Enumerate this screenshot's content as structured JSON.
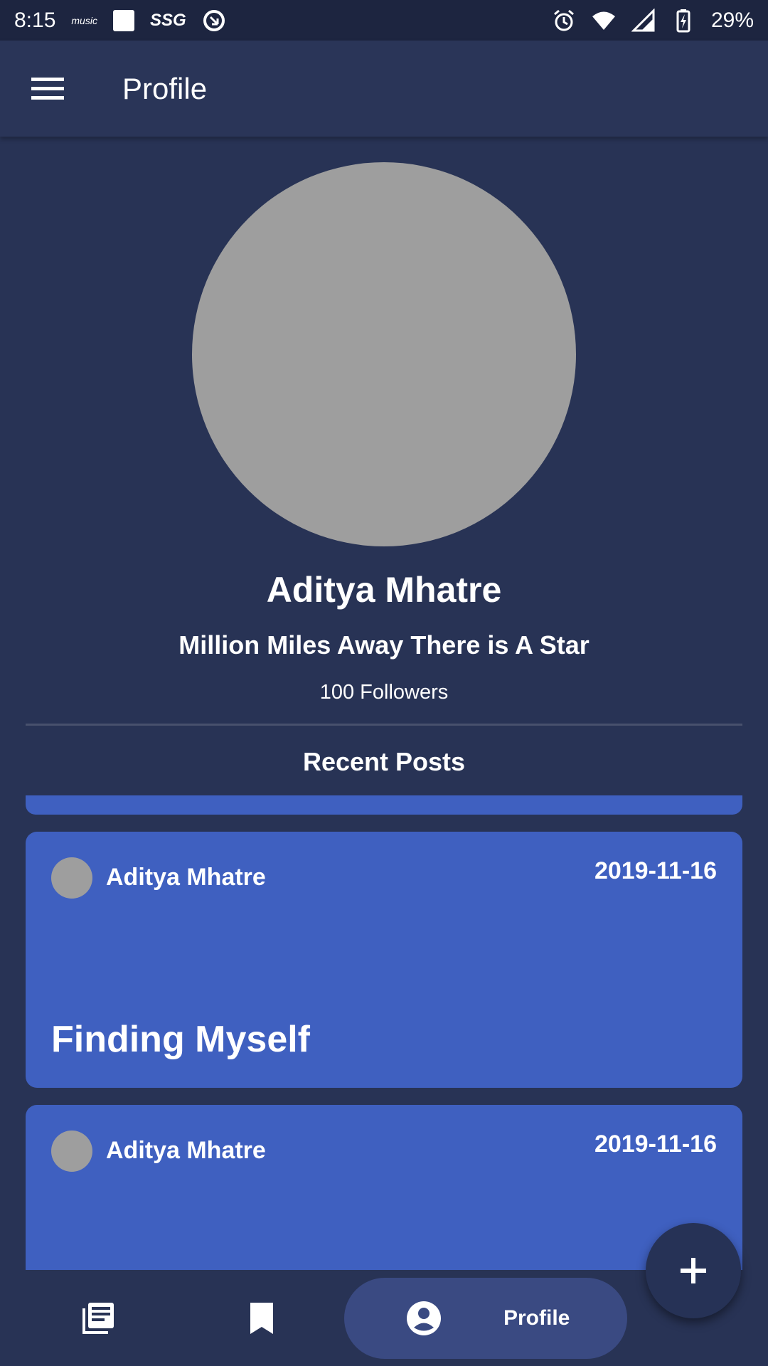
{
  "status_bar": {
    "time": "8:15",
    "music_label": "music",
    "ssg_label": "SSG",
    "battery": "29%"
  },
  "app_bar": {
    "title": "Profile"
  },
  "profile": {
    "name": "Aditya Mhatre",
    "bio": "Million Miles Away There is A Star",
    "followers": "100 Followers"
  },
  "recent_posts": {
    "heading": "Recent Posts",
    "posts": [
      {
        "author": "Aditya Mhatre",
        "date": "2019-11-16",
        "title": "Finding Myself"
      },
      {
        "author": "Aditya Mhatre",
        "date": "2019-11-16",
        "title": ""
      }
    ]
  },
  "bottom_nav": {
    "items": [
      {
        "icon": "feed-icon",
        "label": ""
      },
      {
        "icon": "bookmark-icon",
        "label": ""
      },
      {
        "icon": "account-circle-icon",
        "label": "Profile"
      }
    ]
  },
  "fab": {
    "icon": "plus-icon"
  },
  "colors": {
    "background": "#283355",
    "status_bar": "#1d2540",
    "card": "#3f60c0",
    "nav_active": "#3a4a82",
    "avatar_placeholder": "#9e9e9e"
  }
}
